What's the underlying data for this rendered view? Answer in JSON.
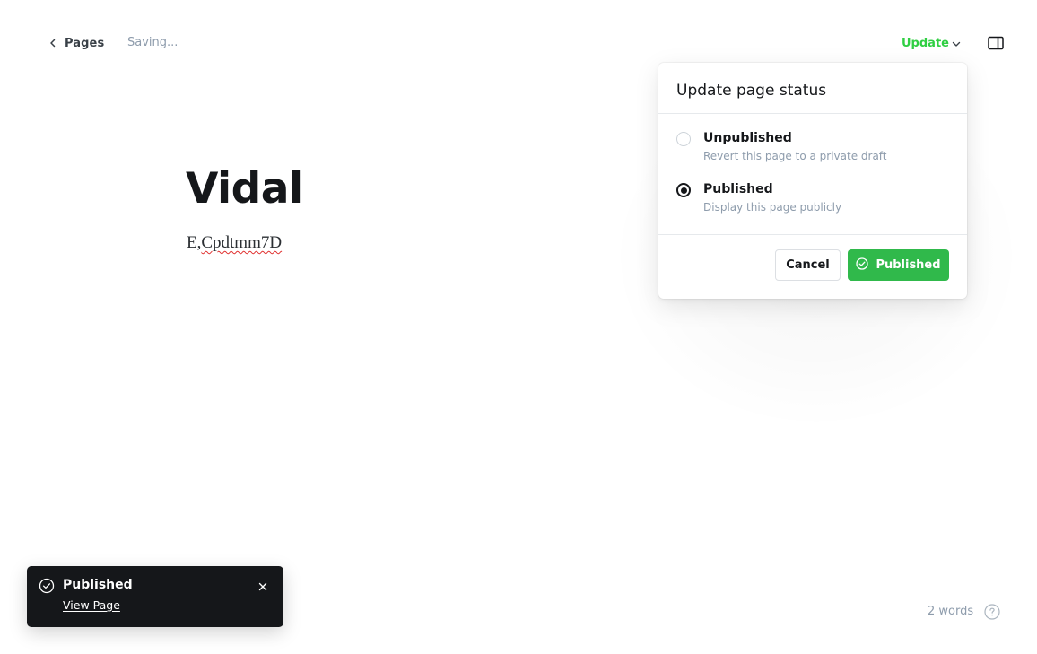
{
  "topbar": {
    "back_label": "Pages",
    "save_status": "Saving...",
    "update_label": "Update",
    "accent_color": "#30cf43"
  },
  "editor": {
    "title": "Vidal",
    "body_prefix": "E,",
    "body_misspelled": "Cpdtmm7D"
  },
  "publish_menu": {
    "heading": "Update page status",
    "options": [
      {
        "title": "Unpublished",
        "description": "Revert this page to a private draft",
        "selected": false
      },
      {
        "title": "Published",
        "description": "Display this page publicly",
        "selected": true
      }
    ],
    "cancel_label": "Cancel",
    "confirm_label": "Published",
    "confirm_color": "#30b94b"
  },
  "footer": {
    "word_count": "2 words",
    "help_icon": "question-circle-icon"
  },
  "toast": {
    "title": "Published",
    "link_label": "View Page",
    "icon": "check-circle-icon",
    "background": "#15171a"
  }
}
